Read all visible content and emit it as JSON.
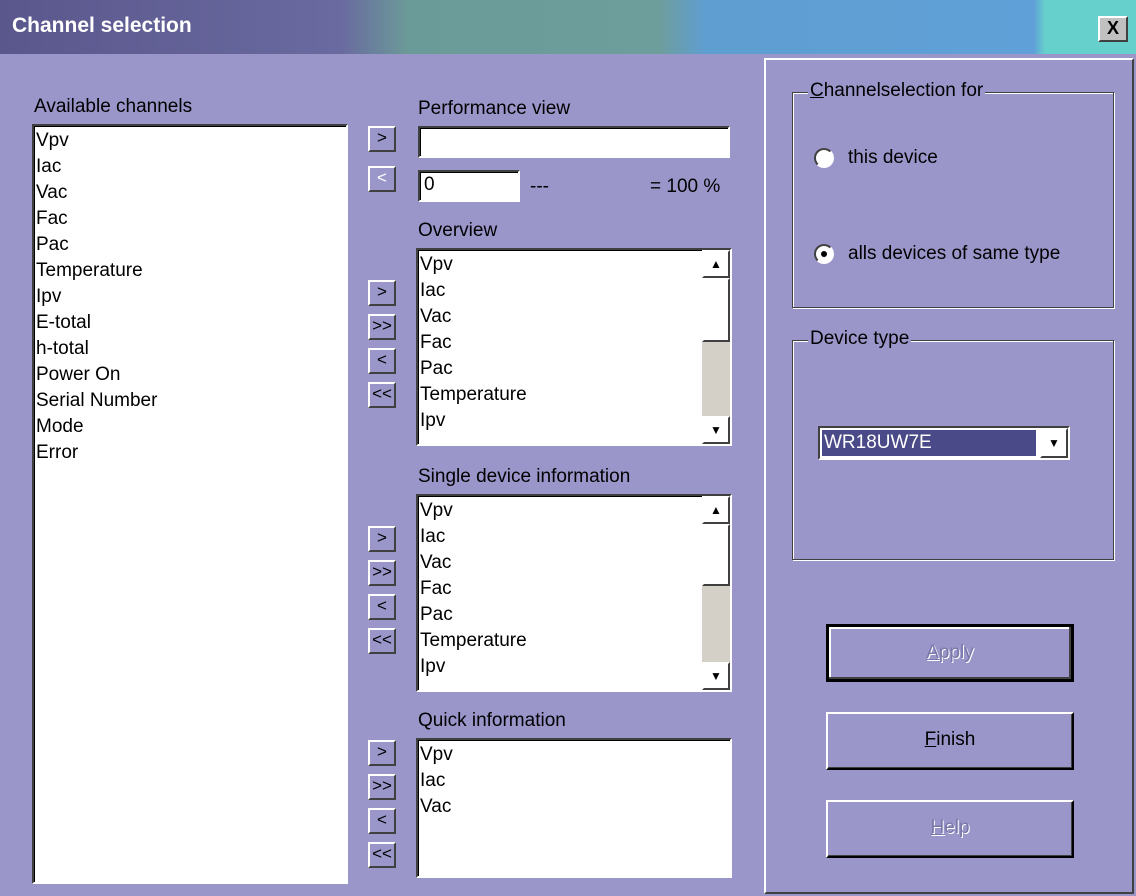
{
  "window": {
    "title": "Channel selection",
    "close_glyph": "X"
  },
  "available": {
    "label": "Available channels",
    "items": [
      "Vpv",
      "Iac",
      "Vac",
      "Fac",
      "Pac",
      "Temperature",
      "Ipv",
      "E-total",
      "h-total",
      "Power On",
      "Serial Number",
      "Mode",
      "Error"
    ]
  },
  "performance": {
    "label": "Performance view",
    "field_value": "",
    "scale_value": "0",
    "dashes": "---",
    "percent_text": "= 100 %",
    "add_glyph": ">",
    "remove_glyph": "<"
  },
  "overview": {
    "label": "Overview",
    "items": [
      "Vpv",
      "Iac",
      "Vac",
      "Fac",
      "Pac",
      "Temperature",
      "Ipv"
    ]
  },
  "single": {
    "label": "Single device information",
    "items": [
      "Vpv",
      "Iac",
      "Vac",
      "Fac",
      "Pac",
      "Temperature",
      "Ipv"
    ]
  },
  "quick": {
    "label": "Quick information",
    "items": [
      "Vpv",
      "Iac",
      "Vac"
    ]
  },
  "move_buttons": {
    "add": ">",
    "add_all": ">>",
    "remove": "<",
    "remove_all": "<<"
  },
  "channelselection": {
    "title_prefix": "C",
    "title_rest": "hannelselection for",
    "options": [
      {
        "label": "this device",
        "selected": false
      },
      {
        "label": "alls devices of same type",
        "selected": true
      }
    ]
  },
  "device_type": {
    "title": "Device type",
    "selected": "WR18UW7E"
  },
  "buttons": {
    "apply_ul": "A",
    "apply_rest": "pply",
    "finish_ul": "F",
    "finish_rest": "inish",
    "help_ul": "H",
    "help_rest": "elp"
  },
  "scroll_glyphs": {
    "up": "▲",
    "down": "▼"
  }
}
